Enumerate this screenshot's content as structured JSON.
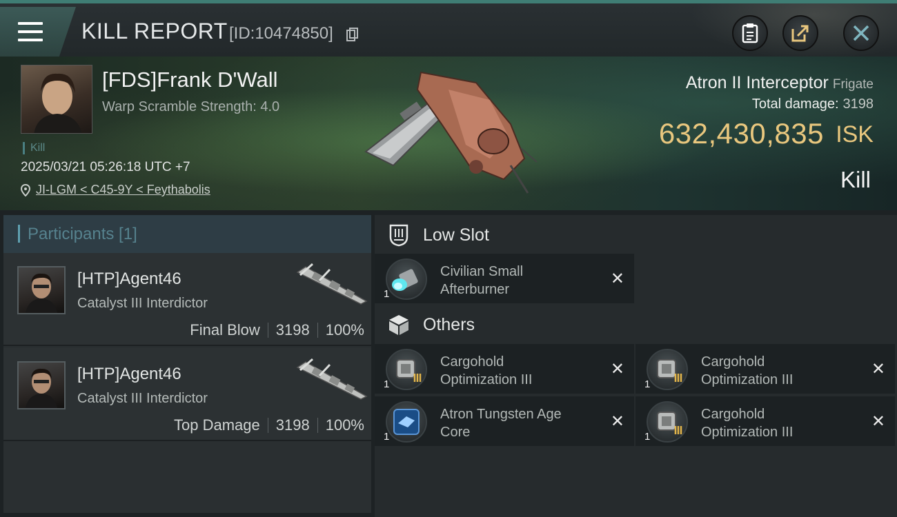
{
  "header": {
    "title": "KILL REPORT",
    "report_id": "[ID:10474850]",
    "buttons": [
      "clipboard",
      "share",
      "close"
    ]
  },
  "victim": {
    "name": "[FDS]Frank D'Wall",
    "warp_scramble": "Warp Scramble Strength: 4.0",
    "tag": "Kill",
    "datetime": "2025/03/21 05:26:18 UTC +7",
    "location": "JI-LGM < C45-9Y < Feythabolis",
    "ship_name": "Atron II Interceptor",
    "ship_class": "Frigate",
    "total_damage_label": "Total damage:",
    "total_damage": "3198",
    "isk_value": "632,430,835",
    "isk_unit": "ISK",
    "result": "Kill"
  },
  "participants": {
    "header": "Participants [1]",
    "rows": [
      {
        "name": "[HTP]Agent46",
        "ship": "Catalyst III Interdictor",
        "role": "Final Blow",
        "damage": "3198",
        "percent": "100%"
      },
      {
        "name": "[HTP]Agent46",
        "ship": "Catalyst III Interdictor",
        "role": "Top Damage",
        "damage": "3198",
        "percent": "100%"
      }
    ]
  },
  "fitting": {
    "low_slot_label": "Low Slot",
    "low_slot": [
      {
        "name_line1": "Civilian Small",
        "name_line2": "Afterburner",
        "qty": "1"
      }
    ],
    "others_label": "Others",
    "others": [
      {
        "name_line1": "Cargohold",
        "name_line2": "Optimization III",
        "qty": "1"
      },
      {
        "name_line1": "Cargohold",
        "name_line2": "Optimization III",
        "qty": "1"
      },
      {
        "name_line1": "Atron Tungsten Age",
        "name_line2": "Core",
        "qty": "1"
      },
      {
        "name_line1": "Cargohold",
        "name_line2": "Optimization III",
        "qty": "1"
      }
    ],
    "remove_glyph": "✕"
  },
  "colors": {
    "accent_teal": "#3f7d74",
    "isk_gold": "#e9c77e"
  }
}
